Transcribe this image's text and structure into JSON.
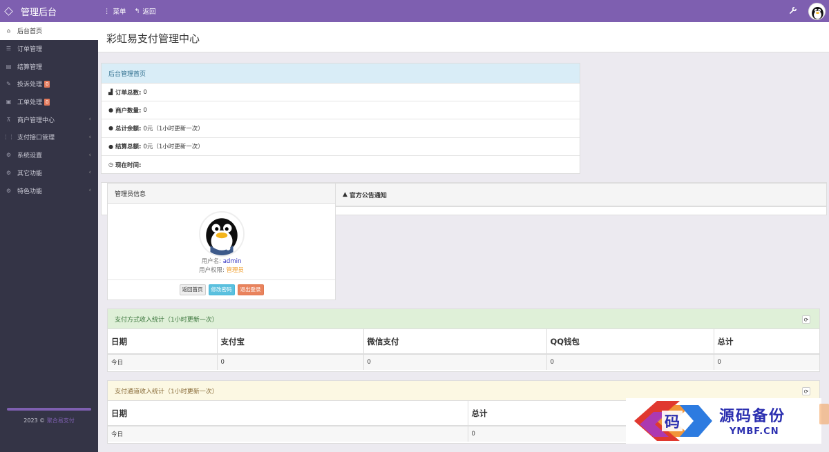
{
  "brand": {
    "title": "管理后台"
  },
  "topnav": {
    "menu": "菜单",
    "back": "返回"
  },
  "sidebar": {
    "items": [
      {
        "label": "后台首页",
        "badge": "",
        "active": true
      },
      {
        "label": "订单管理",
        "badge": ""
      },
      {
        "label": "结算管理",
        "badge": ""
      },
      {
        "label": "投诉处理",
        "badge": "0"
      },
      {
        "label": "工单处理",
        "badge": "0"
      },
      {
        "label": "商户管理中心",
        "badge": "",
        "chevron": true
      },
      {
        "label": "支付接口管理",
        "badge": "",
        "chevron": true
      },
      {
        "label": "系统设置",
        "badge": "",
        "chevron": true
      },
      {
        "label": "其它功能",
        "badge": "",
        "chevron": true
      },
      {
        "label": "特色功能",
        "badge": "",
        "chevron": true
      }
    ],
    "footer_prefix": "2023 ©",
    "footer_link": "聚合易支付"
  },
  "page": {
    "title": "彩虹易支付管理中心"
  },
  "overview": {
    "heading": "后台管理首页",
    "rows": [
      {
        "label": "订单总数:",
        "value": "0"
      },
      {
        "label": "商户数量:",
        "value": "0"
      },
      {
        "label": "总计余额:",
        "value": "0元（1小时更新一次）"
      },
      {
        "label": "结算总额:",
        "value": "0元（1小时更新一次）"
      },
      {
        "label": "现在时间:",
        "value": ""
      }
    ]
  },
  "admin": {
    "heading": "管理员信息",
    "username_label": "用户名:",
    "username": "admin",
    "role_label": "用户权限:",
    "role": "管理员",
    "btn_home": "返回首页",
    "btn_password": "修改密码",
    "btn_logout": "退出登录"
  },
  "notice": {
    "heading": "官方公告通知"
  },
  "payment_stats": {
    "heading": "支付方式收入统计（1小时更新一次）",
    "columns": [
      "日期",
      "支付宝",
      "微信支付",
      "QQ钱包",
      "总计"
    ],
    "rows": [
      [
        "今日",
        "0",
        "0",
        "0",
        "0"
      ]
    ]
  },
  "channel_stats": {
    "heading": "支付通道收入统计（1小时更新一次）",
    "columns": [
      "日期",
      "总计"
    ],
    "rows": [
      [
        "今日",
        "0"
      ]
    ]
  },
  "watermark": {
    "text": "源码备份",
    "sub": "YMBF.CN",
    "logo_char": "码"
  },
  "colors": {
    "accent": "#7e5fb0",
    "sidebar": "#343446",
    "badge": "#e57a5b"
  }
}
